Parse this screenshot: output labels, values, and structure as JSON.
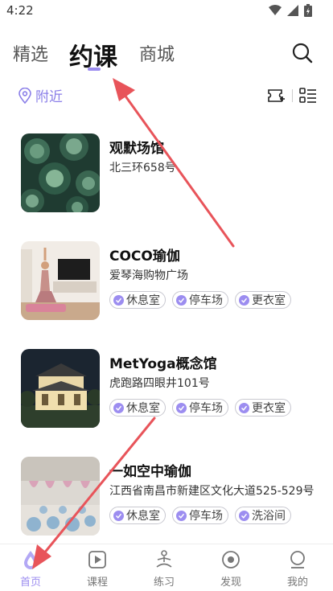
{
  "status_bar": {
    "time": "4:22"
  },
  "top_tabs": [
    {
      "label": "精选",
      "active": false
    },
    {
      "label": "约课",
      "active": true
    },
    {
      "label": "商城",
      "active": false
    }
  ],
  "filter": {
    "location_label": "附近"
  },
  "venues": [
    {
      "name": "观默场馆",
      "address": "北三环658号",
      "tags": []
    },
    {
      "name": "COCO瑜伽",
      "address": "爱琴海购物广场",
      "tags": [
        "休息室",
        "停车场",
        "更衣室"
      ]
    },
    {
      "name": "MetYoga概念馆",
      "address": "虎跑路四眼井101号",
      "tags": [
        "休息室",
        "停车场",
        "更衣室"
      ]
    },
    {
      "name": "一如空中瑜伽",
      "address": "江西省南昌市新建区文化大道525-529号",
      "tags": [
        "休息室",
        "停车场",
        "洗浴间"
      ]
    }
  ],
  "bottom_nav": [
    {
      "label": "首页",
      "icon": "drop-icon",
      "active": true
    },
    {
      "label": "课程",
      "icon": "play-icon",
      "active": false
    },
    {
      "label": "练习",
      "icon": "yoga-pose-icon",
      "active": false
    },
    {
      "label": "发现",
      "icon": "discover-icon",
      "active": false
    },
    {
      "label": "我的",
      "icon": "profile-icon",
      "active": false
    }
  ],
  "colors": {
    "accent": "#9c8df0",
    "arrow": "#e8545a"
  }
}
